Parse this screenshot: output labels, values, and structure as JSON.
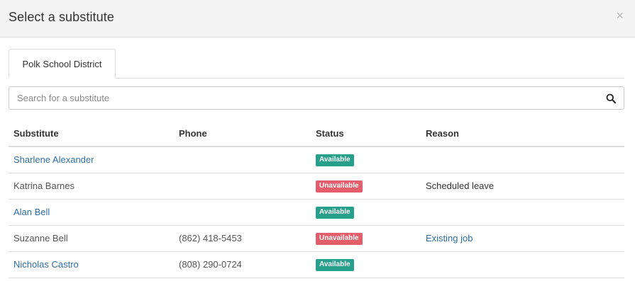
{
  "modal": {
    "title": "Select a substitute",
    "close_label": "×"
  },
  "tabs": [
    {
      "label": "Polk School District",
      "active": true
    }
  ],
  "search": {
    "placeholder": "Search for a substitute",
    "value": "",
    "icon": "search-icon"
  },
  "table": {
    "headers": {
      "substitute": "Substitute",
      "phone": "Phone",
      "status": "Status",
      "reason": "Reason"
    },
    "rows": [
      {
        "name": "Sharlene Alexander",
        "name_is_link": true,
        "phone": "",
        "status": "Available",
        "status_type": "available",
        "reason": "",
        "reason_is_link": false
      },
      {
        "name": "Katrina Barnes",
        "name_is_link": false,
        "phone": "",
        "status": "Unavailable",
        "status_type": "unavailable",
        "reason": "Scheduled leave",
        "reason_is_link": false
      },
      {
        "name": "Alan Bell",
        "name_is_link": true,
        "phone": "",
        "status": "Available",
        "status_type": "available",
        "reason": "",
        "reason_is_link": false
      },
      {
        "name": "Suzanne Bell",
        "name_is_link": false,
        "phone": "(862) 418-5453",
        "status": "Unavailable",
        "status_type": "unavailable",
        "reason": "Existing job",
        "reason_is_link": true
      },
      {
        "name": "Nicholas Castro",
        "name_is_link": true,
        "phone": "(808) 290-0724",
        "status": "Available",
        "status_type": "available",
        "reason": "",
        "reason_is_link": false
      }
    ]
  },
  "colors": {
    "link": "#2f6ea5",
    "available": "#26a08a",
    "unavailable": "#e35d6a",
    "header_bg": "#f3f3f3"
  }
}
